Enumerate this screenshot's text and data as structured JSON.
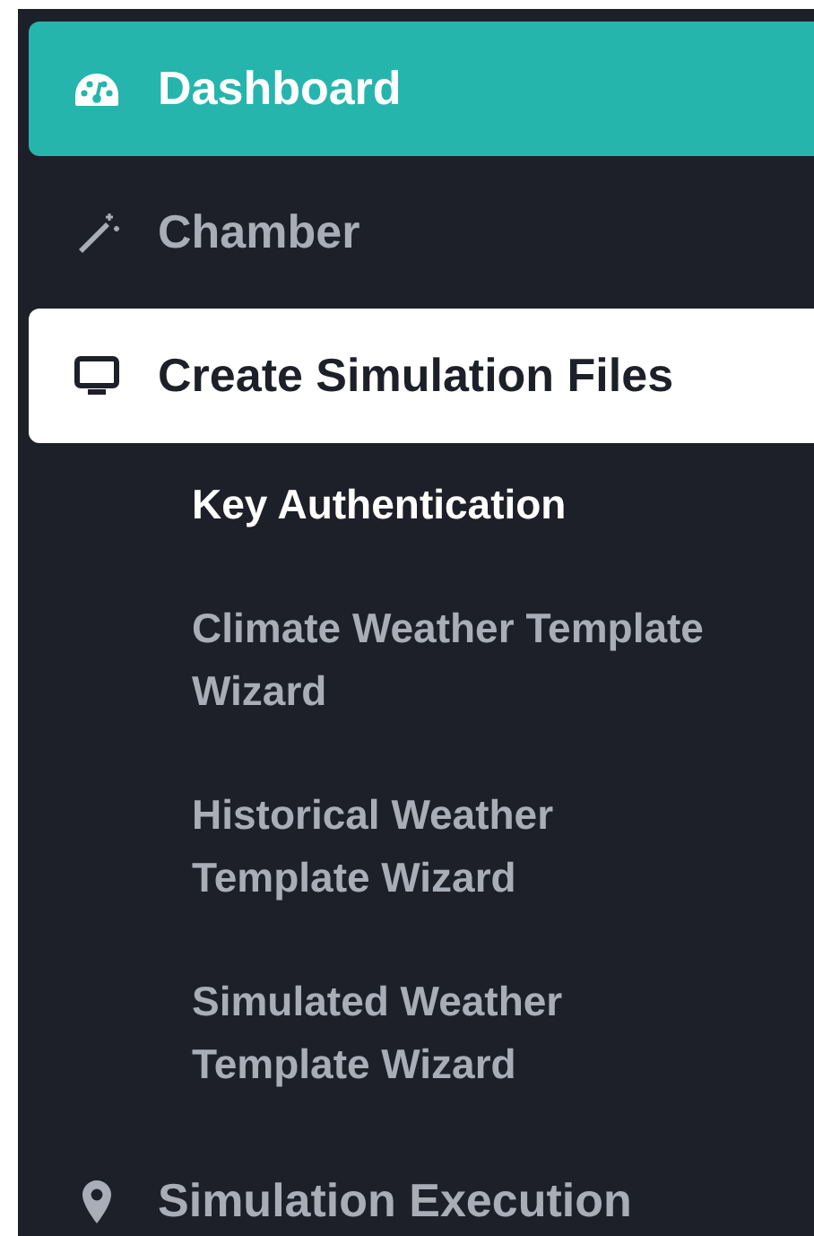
{
  "sidebar": {
    "items": [
      {
        "label": "Dashboard",
        "selected": true,
        "expanded": false
      },
      {
        "label": "Chamber",
        "selected": false,
        "expanded": false
      },
      {
        "label": "Create Simulation Files",
        "selected": false,
        "expanded": true,
        "children": [
          {
            "label": "Key Authentication",
            "selected": true
          },
          {
            "label": "Climate Weather Template Wizard",
            "selected": false
          },
          {
            "label": "Historical Weather Template Wizard",
            "selected": false
          },
          {
            "label": "Simulated Weather Template Wizard",
            "selected": false
          }
        ]
      },
      {
        "label": "Simulation Execution",
        "selected": false,
        "expanded": false
      }
    ]
  }
}
